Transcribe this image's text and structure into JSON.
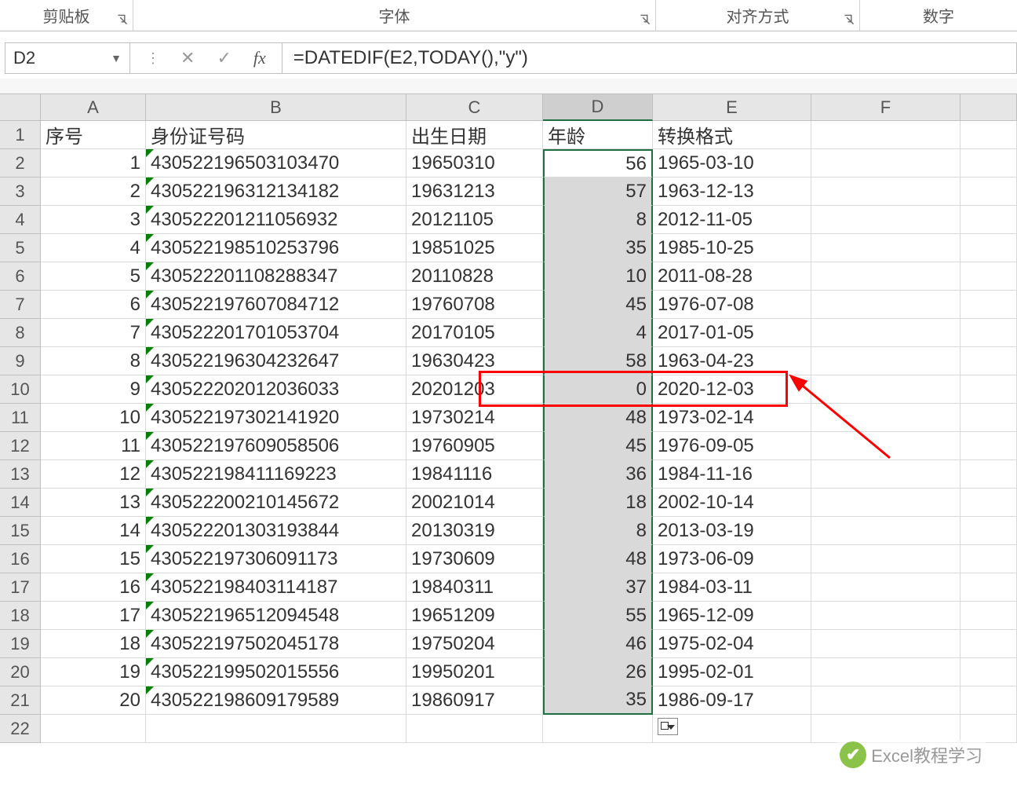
{
  "ribbon": {
    "clipboard": "剪贴板",
    "font": "字体",
    "alignment": "对齐方式",
    "number": "数字"
  },
  "nameBox": "D2",
  "formulaBar": {
    "cancel": "✕",
    "enter": "✓",
    "fx": "fx",
    "value": "=DATEDIF(E2,TODAY(),\"y\")"
  },
  "columns": [
    "A",
    "B",
    "C",
    "D",
    "E",
    "F"
  ],
  "headers": {
    "A": "序号",
    "B": "身份证号码",
    "C": "出生日期",
    "D": "年龄",
    "E": "转换格式"
  },
  "rows": [
    {
      "n": "1",
      "id": "430522196503103470",
      "dob": "19650310",
      "age": "56",
      "fmt": "1965-03-10"
    },
    {
      "n": "2",
      "id": "430522196312134182",
      "dob": "19631213",
      "age": "57",
      "fmt": "1963-12-13"
    },
    {
      "n": "3",
      "id": "430522201211056932",
      "dob": "20121105",
      "age": "8",
      "fmt": "2012-11-05"
    },
    {
      "n": "4",
      "id": "430522198510253796",
      "dob": "19851025",
      "age": "35",
      "fmt": "1985-10-25"
    },
    {
      "n": "5",
      "id": "430522201108288347",
      "dob": "20110828",
      "age": "10",
      "fmt": "2011-08-28"
    },
    {
      "n": "6",
      "id": "430522197607084712",
      "dob": "19760708",
      "age": "45",
      "fmt": "1976-07-08"
    },
    {
      "n": "7",
      "id": "430522201701053704",
      "dob": "20170105",
      "age": "4",
      "fmt": "2017-01-05"
    },
    {
      "n": "8",
      "id": "430522196304232647",
      "dob": "19630423",
      "age": "58",
      "fmt": "1963-04-23"
    },
    {
      "n": "9",
      "id": "430522202012036033",
      "dob": "20201203",
      "age": "0",
      "fmt": "2020-12-03"
    },
    {
      "n": "10",
      "id": "430522197302141920",
      "dob": "19730214",
      "age": "48",
      "fmt": "1973-02-14"
    },
    {
      "n": "11",
      "id": "430522197609058506",
      "dob": "19760905",
      "age": "45",
      "fmt": "1976-09-05"
    },
    {
      "n": "12",
      "id": "430522198411169223",
      "dob": "19841116",
      "age": "36",
      "fmt": "1984-11-16"
    },
    {
      "n": "13",
      "id": "430522200210145672",
      "dob": "20021014",
      "age": "18",
      "fmt": "2002-10-14"
    },
    {
      "n": "14",
      "id": "430522201303193844",
      "dob": "20130319",
      "age": "8",
      "fmt": "2013-03-19"
    },
    {
      "n": "15",
      "id": "430522197306091173",
      "dob": "19730609",
      "age": "48",
      "fmt": "1973-06-09"
    },
    {
      "n": "16",
      "id": "430522198403114187",
      "dob": "19840311",
      "age": "37",
      "fmt": "1984-03-11"
    },
    {
      "n": "17",
      "id": "430522196512094548",
      "dob": "19651209",
      "age": "55",
      "fmt": "1965-12-09"
    },
    {
      "n": "18",
      "id": "430522197502045178",
      "dob": "19750204",
      "age": "46",
      "fmt": "1975-02-04"
    },
    {
      "n": "19",
      "id": "430522199502015556",
      "dob": "19950201",
      "age": "26",
      "fmt": "1995-02-01"
    },
    {
      "n": "20",
      "id": "430522198609179589",
      "dob": "19860917",
      "age": "35",
      "fmt": "1986-09-17"
    }
  ],
  "watermark": "Excel教程学习",
  "lastVisibleRow": 22,
  "highlightRowIndex": 10
}
